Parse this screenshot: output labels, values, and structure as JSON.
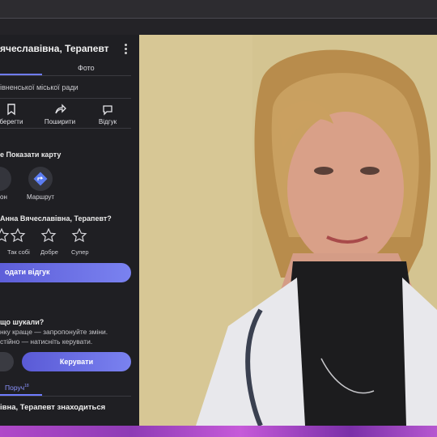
{
  "panel": {
    "title": "ячеславівна, Терапевт",
    "tab_photo": "Фото",
    "organization": "івненської міської ради",
    "actions": [
      {
        "label": "берегти",
        "icon": "bookmark-icon"
      },
      {
        "label": "Поширити",
        "icon": "share-icon"
      },
      {
        "label": "Відгук",
        "icon": "review-icon"
      }
    ],
    "map_title": "е Показати карту",
    "map_buttons": [
      {
        "label": "он",
        "icon": "phone-icon"
      },
      {
        "label": "Маршрут",
        "icon": "route-icon"
      }
    ],
    "rate_question": "Анна Вячеславівна, Терапевт?",
    "ratings": [
      "Так собі",
      "Добре",
      "Супер"
    ],
    "review_button": "одати відгук",
    "found_question": "що шукали?",
    "found_line1": "нку краще — запропонуйте зміни.",
    "found_line2": "стійно — натисніть керувати.",
    "manage_button": "Керувати",
    "nearby_tab": "Поруч",
    "nearby_sup": "18",
    "location_text": "івна, Терапевт знаходиться"
  },
  "colors": {
    "accent": "#6f7cff",
    "panel_bg": "#1f1f23",
    "button_gradient_start": "#5a5ad6",
    "button_gradient_end": "#7a82f0"
  }
}
